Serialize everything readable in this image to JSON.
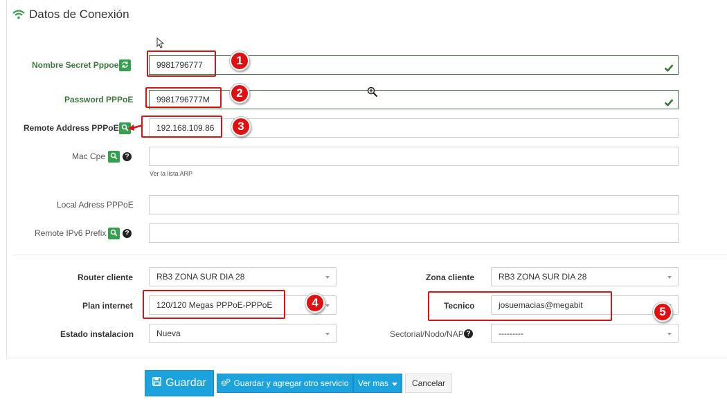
{
  "section": {
    "title": "Datos de Conexión",
    "icon": "wifi-icon"
  },
  "fields": {
    "pppoe_secret": {
      "label": "Nombre Secret Pppoe",
      "value": "9981796777"
    },
    "pppoe_password": {
      "label": "Password PPPoE",
      "value": "9981796777M"
    },
    "remote_address": {
      "label": "Remote Address PPPoE",
      "value": "192.168.109.86"
    },
    "mac_cpe": {
      "label": "Mac Cpe",
      "value": "",
      "hint": "Ver la lista ARP"
    },
    "local_address": {
      "label": "Local Adress PPPoE",
      "value": ""
    },
    "remote_ipv6": {
      "label": "Remote IPv6 Prefix",
      "value": ""
    }
  },
  "selects": {
    "router_cliente": {
      "label": "Router cliente",
      "value": "RB3 ZONA SUR DIA 28"
    },
    "zona_cliente": {
      "label": "Zona cliente",
      "value": "RB3 ZONA SUR DIA 28"
    },
    "plan_internet": {
      "label": "Plan internet",
      "value": "120/120 Megas PPPoE-PPPoE"
    },
    "tecnico": {
      "label": "Tecnico",
      "value": "josuemacias@megabit"
    },
    "estado_instalacion": {
      "label": "Estado instalacion",
      "value": "Nueva"
    },
    "sectorial": {
      "label": "Sectorial/Nodo/NAP",
      "value": "---------"
    }
  },
  "annotations": [
    "1",
    "2",
    "3",
    "4",
    "5"
  ],
  "buttons": {
    "save": "Guardar",
    "save_add": "Guardar y agregar otro servicio",
    "more": "Ver mas",
    "cancel": "Cancelar"
  },
  "colors": {
    "accent": "#1ca3dd",
    "success": "#3c763d",
    "icon_button": "#35a14e",
    "annotation": "#e01010"
  }
}
